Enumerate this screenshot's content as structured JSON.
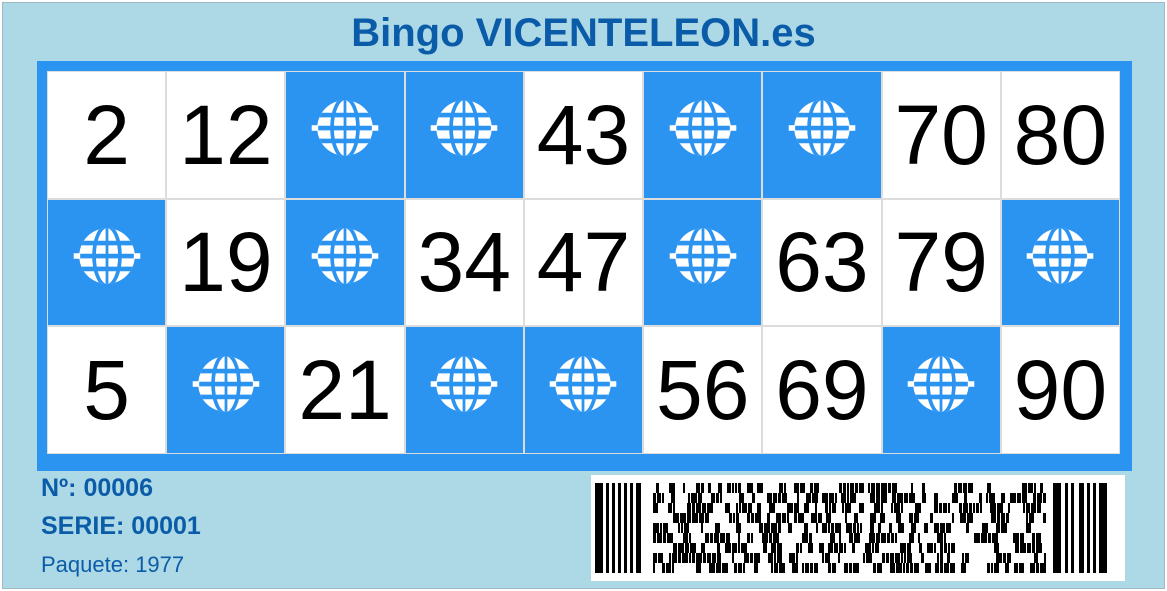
{
  "title": "Bingo VICENTELEON.es",
  "board": {
    "rows": [
      [
        "2",
        "12",
        "",
        "",
        "43",
        "",
        "",
        "70",
        "80"
      ],
      [
        "",
        "19",
        "",
        "34",
        "47",
        "",
        "63",
        "79",
        ""
      ],
      [
        "5",
        "",
        "21",
        "",
        "",
        "56",
        "69",
        "",
        "90"
      ]
    ],
    "empty_icon": "bingo-ball-cage-icon",
    "colors": {
      "accent": "#2b93f0",
      "background": "#add8e6",
      "title": "#0b5ca8"
    }
  },
  "info": {
    "numero": "Nº: 00006",
    "serie": "SERIE: 00001",
    "paquete": "Paquete: 1977"
  },
  "barcode_icon": "pdf417-barcode-icon"
}
